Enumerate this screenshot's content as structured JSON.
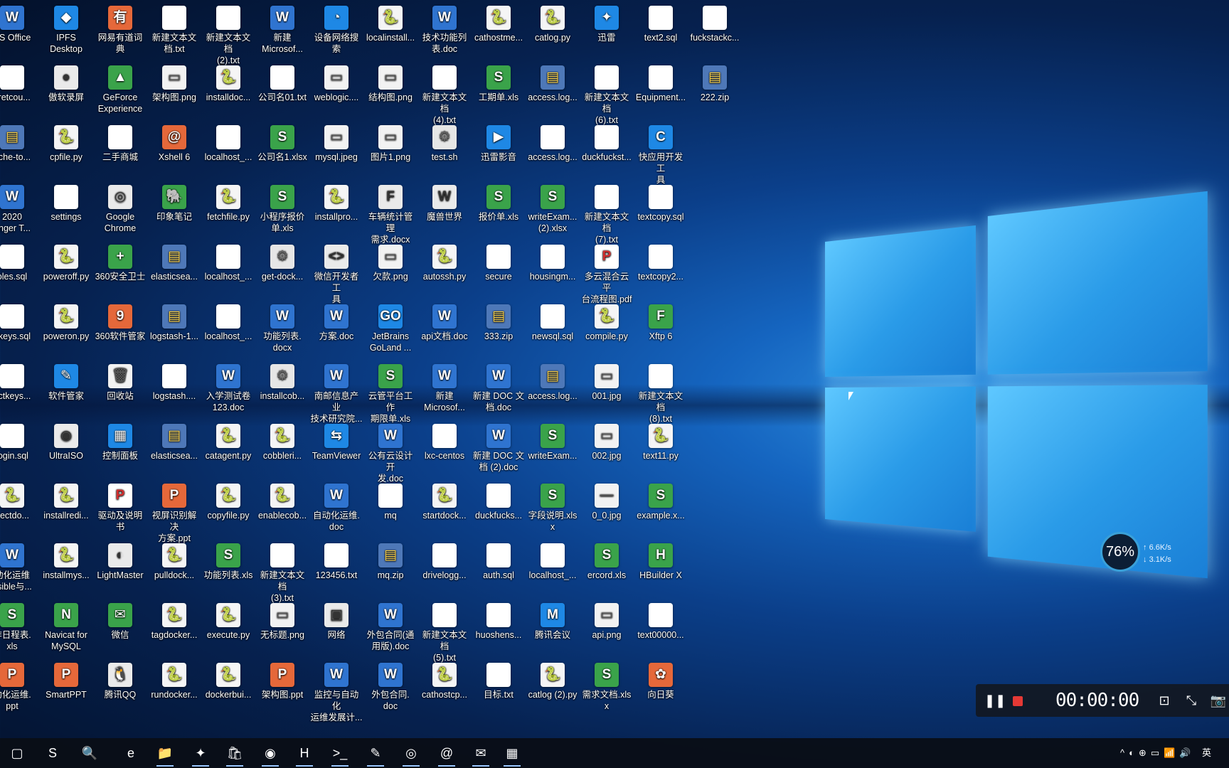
{
  "desktop": {
    "columns": [
      [
        {
          "label": "PS Office",
          "type": "word",
          "glyph": "W"
        },
        {
          "label": "cretcou...",
          "type": "doc",
          "glyph": ""
        },
        {
          "label": "ache-to...",
          "type": "zip",
          "glyph": "▤"
        },
        {
          "label": "2020\nonger T...",
          "type": "word",
          "glyph": "W"
        },
        {
          "label": "oles.sql",
          "type": "doc",
          "glyph": ""
        },
        {
          "label": "hkeys.sql",
          "type": "doc",
          "glyph": ""
        },
        {
          "label": "ectkeys...",
          "type": "doc",
          "glyph": ""
        },
        {
          "label": "login.sql",
          "type": "doc",
          "glyph": ""
        },
        {
          "label": "pectdo...",
          "type": "py",
          "glyph": "🐍"
        },
        {
          "label": "动化运维\nnsible与...",
          "type": "word",
          "glyph": "W"
        },
        {
          "label": "作日程表.\nxls",
          "type": "xls",
          "glyph": "S"
        },
        {
          "label": "动化运维.\nppt",
          "type": "ppt",
          "glyph": "P"
        }
      ],
      [
        {
          "label": "IPFS\nDesktop",
          "type": "app",
          "glyph": "◆"
        },
        {
          "label": "傲软录屏",
          "type": "exe",
          "glyph": "●"
        },
        {
          "label": "cpfile.py",
          "type": "py",
          "glyph": "🐍"
        },
        {
          "label": "settings",
          "type": "doc",
          "glyph": ""
        },
        {
          "label": "poweroff.py",
          "type": "py",
          "glyph": "🐍"
        },
        {
          "label": "poweron.py",
          "type": "py",
          "glyph": "🐍"
        },
        {
          "label": "软件管家",
          "type": "app",
          "glyph": "✎"
        },
        {
          "label": "UltraISO",
          "type": "exe",
          "glyph": "◉"
        },
        {
          "label": "installredi...",
          "type": "py",
          "glyph": "🐍"
        },
        {
          "label": "installmys...",
          "type": "py",
          "glyph": "🐍"
        },
        {
          "label": "Navicat for\nMySQL",
          "type": "xls",
          "glyph": "N"
        },
        {
          "label": "SmartPPT",
          "type": "ppt",
          "glyph": "P"
        }
      ],
      [
        {
          "label": "网易有道词典",
          "type": "ppt",
          "glyph": "有"
        },
        {
          "label": "GeForce\nExperience",
          "type": "xls",
          "glyph": "▲"
        },
        {
          "label": "二手商城",
          "type": "doc",
          "glyph": ""
        },
        {
          "label": "Google\nChrome",
          "type": "exe",
          "glyph": "◎"
        },
        {
          "label": "360安全卫士",
          "type": "xls",
          "glyph": "+"
        },
        {
          "label": "360软件管家",
          "type": "ppt",
          "glyph": "9"
        },
        {
          "label": "回收站",
          "type": "img",
          "glyph": "🗑"
        },
        {
          "label": "控制面板",
          "type": "app",
          "glyph": "▦"
        },
        {
          "label": "驱动及说明书",
          "type": "pdf",
          "glyph": "P"
        },
        {
          "label": "LightMaster",
          "type": "exe",
          "glyph": "◐"
        },
        {
          "label": "微信",
          "type": "xls",
          "glyph": "✉"
        },
        {
          "label": "腾讯QQ",
          "type": "exe",
          "glyph": "🐧"
        }
      ],
      [
        {
          "label": "新建文本文\n档.txt",
          "type": "doc",
          "glyph": ""
        },
        {
          "label": "架构图.png",
          "type": "img",
          "glyph": "▭"
        },
        {
          "label": "Xshell 6",
          "type": "ppt",
          "glyph": "@"
        },
        {
          "label": "印象笔记",
          "type": "xls",
          "glyph": "🐘"
        },
        {
          "label": "elasticsea...",
          "type": "zip",
          "glyph": "▤"
        },
        {
          "label": "logstash-1...",
          "type": "zip",
          "glyph": "▤"
        },
        {
          "label": "logstash....",
          "type": "doc",
          "glyph": ""
        },
        {
          "label": "elasticsea...",
          "type": "zip",
          "glyph": "▤"
        },
        {
          "label": "视屏识别解决\n方案.ppt",
          "type": "ppt",
          "glyph": "P"
        },
        {
          "label": "pulldock...",
          "type": "py",
          "glyph": "🐍"
        },
        {
          "label": "tagdocker...",
          "type": "py",
          "glyph": "🐍"
        },
        {
          "label": "rundocker...",
          "type": "py",
          "glyph": "🐍"
        }
      ],
      [
        {
          "label": "新建文本文档\n(2).txt",
          "type": "doc",
          "glyph": ""
        },
        {
          "label": "installdoc...",
          "type": "py",
          "glyph": "🐍"
        },
        {
          "label": "localhost_...",
          "type": "doc",
          "glyph": ""
        },
        {
          "label": "fetchfile.py",
          "type": "py",
          "glyph": "🐍"
        },
        {
          "label": "localhost_...",
          "type": "doc",
          "glyph": ""
        },
        {
          "label": "localhost_...",
          "type": "doc",
          "glyph": ""
        },
        {
          "label": "入学测试卷\n123.doc",
          "type": "word",
          "glyph": "W"
        },
        {
          "label": "catagent.py",
          "type": "py",
          "glyph": "🐍"
        },
        {
          "label": "copyfile.py",
          "type": "py",
          "glyph": "🐍"
        },
        {
          "label": "功能列表.xls",
          "type": "xls",
          "glyph": "S"
        },
        {
          "label": "execute.py",
          "type": "py",
          "glyph": "🐍"
        },
        {
          "label": "dockerbui...",
          "type": "py",
          "glyph": "🐍"
        }
      ],
      [
        {
          "label": "新建\nMicrosof...",
          "type": "word",
          "glyph": "W"
        },
        {
          "label": "公司名01.txt",
          "type": "doc",
          "glyph": ""
        },
        {
          "label": "公司名1.xlsx",
          "type": "xls",
          "glyph": "S"
        },
        {
          "label": "小程序报价\n单.xls",
          "type": "xls",
          "glyph": "S"
        },
        {
          "label": "get-dock...",
          "type": "sh",
          "glyph": "⚙"
        },
        {
          "label": "功能列表.\ndocx",
          "type": "word",
          "glyph": "W"
        },
        {
          "label": "installcob...",
          "type": "sh",
          "glyph": "⚙"
        },
        {
          "label": "cobbleri...",
          "type": "py",
          "glyph": "🐍"
        },
        {
          "label": "enablecob...",
          "type": "py",
          "glyph": "🐍"
        },
        {
          "label": "新建文本文档\n(3).txt",
          "type": "doc",
          "glyph": ""
        },
        {
          "label": "无标题.png",
          "type": "img",
          "glyph": "▭"
        },
        {
          "label": "架构图.ppt",
          "type": "ppt",
          "glyph": "P"
        }
      ],
      [
        {
          "label": "设备网络搜索",
          "type": "app",
          "glyph": "◔"
        },
        {
          "label": "weblogic....",
          "type": "img",
          "glyph": "▭"
        },
        {
          "label": "mysql.jpeg",
          "type": "img",
          "glyph": "▭"
        },
        {
          "label": "installpro...",
          "type": "py",
          "glyph": "🐍"
        },
        {
          "label": "微信开发者工\n具",
          "type": "exe",
          "glyph": "<>"
        },
        {
          "label": "方案.doc",
          "type": "word",
          "glyph": "W"
        },
        {
          "label": "南邮信息产业\n技术研究院...",
          "type": "word",
          "glyph": "W"
        },
        {
          "label": "TeamViewer",
          "type": "app",
          "glyph": "⇆"
        },
        {
          "label": "自动化运维.\ndoc",
          "type": "word",
          "glyph": "W"
        },
        {
          "label": "123456.txt",
          "type": "doc",
          "glyph": ""
        },
        {
          "label": "网络",
          "type": "exe",
          "glyph": "▣"
        },
        {
          "label": "监控与自动化\n运维发展计...",
          "type": "word",
          "glyph": "W"
        }
      ],
      [
        {
          "label": "localinstall...",
          "type": "py",
          "glyph": "🐍"
        },
        {
          "label": "结构图.png",
          "type": "img",
          "glyph": "▭"
        },
        {
          "label": "图片1.png",
          "type": "img",
          "glyph": "▭"
        },
        {
          "label": "车辆统计管理\n需求.docx",
          "type": "exe",
          "glyph": "F"
        },
        {
          "label": "欠款.png",
          "type": "img",
          "glyph": "▭"
        },
        {
          "label": "JetBrains\nGoLand ...",
          "type": "app",
          "glyph": "GO"
        },
        {
          "label": "云管平台工作\n期限单.xls",
          "type": "xls",
          "glyph": "S"
        },
        {
          "label": "公有云设计开\n发.doc",
          "type": "word",
          "glyph": "W"
        },
        {
          "label": "mq",
          "type": "doc",
          "glyph": ""
        },
        {
          "label": "mq.zip",
          "type": "zip",
          "glyph": "▤"
        },
        {
          "label": "外包合同(通\n用版).doc",
          "type": "word",
          "glyph": "W"
        },
        {
          "label": "外包合同.\ndoc",
          "type": "word",
          "glyph": "W"
        }
      ],
      [
        {
          "label": "技术功能列\n表.doc",
          "type": "word",
          "glyph": "W"
        },
        {
          "label": "新建文本文档\n(4).txt",
          "type": "doc",
          "glyph": ""
        },
        {
          "label": "test.sh",
          "type": "sh",
          "glyph": "⚙"
        },
        {
          "label": "魔兽世界",
          "type": "exe",
          "glyph": "W"
        },
        {
          "label": "autossh.py",
          "type": "py",
          "glyph": "🐍"
        },
        {
          "label": "api文档.doc",
          "type": "word",
          "glyph": "W"
        },
        {
          "label": "新建\nMicrosof...",
          "type": "word",
          "glyph": "W"
        },
        {
          "label": "lxc-centos",
          "type": "doc",
          "glyph": ""
        },
        {
          "label": "startdock...",
          "type": "py",
          "glyph": "🐍"
        },
        {
          "label": "drivelogg...",
          "type": "doc",
          "glyph": ""
        },
        {
          "label": "新建文本文档\n(5).txt",
          "type": "doc",
          "glyph": ""
        },
        {
          "label": "cathostcp...",
          "type": "py",
          "glyph": "🐍"
        }
      ],
      [
        {
          "label": "cathostme...",
          "type": "py",
          "glyph": "🐍"
        },
        {
          "label": "工期单.xls",
          "type": "xls",
          "glyph": "S"
        },
        {
          "label": "迅雷影音",
          "type": "app",
          "glyph": "▶"
        },
        {
          "label": "报价单.xls",
          "type": "xls",
          "glyph": "S"
        },
        {
          "label": "secure",
          "type": "doc",
          "glyph": ""
        },
        {
          "label": "333.zip",
          "type": "zip",
          "glyph": "▤"
        },
        {
          "label": "新建 DOC 文\n档.doc",
          "type": "word",
          "glyph": "W"
        },
        {
          "label": "新建 DOC 文\n档 (2).doc",
          "type": "word",
          "glyph": "W"
        },
        {
          "label": "duckfucks...",
          "type": "doc",
          "glyph": ""
        },
        {
          "label": "auth.sql",
          "type": "doc",
          "glyph": ""
        },
        {
          "label": "huoshens...",
          "type": "doc",
          "glyph": ""
        },
        {
          "label": "目标.txt",
          "type": "doc",
          "glyph": ""
        }
      ],
      [
        {
          "label": "catlog.py",
          "type": "py",
          "glyph": "🐍"
        },
        {
          "label": "access.log...",
          "type": "zip",
          "glyph": "▤"
        },
        {
          "label": "access.log...",
          "type": "doc",
          "glyph": ""
        },
        {
          "label": "writeExam...\n(2).xlsx",
          "type": "xls",
          "glyph": "S"
        },
        {
          "label": "housingm...",
          "type": "doc",
          "glyph": ""
        },
        {
          "label": "newsql.sql",
          "type": "doc",
          "glyph": ""
        },
        {
          "label": "access.log...",
          "type": "zip",
          "glyph": "▤"
        },
        {
          "label": "writeExam...",
          "type": "xls",
          "glyph": "S"
        },
        {
          "label": "字段说明.xlsx",
          "type": "xls",
          "glyph": "S"
        },
        {
          "label": "localhost_...",
          "type": "doc",
          "glyph": ""
        },
        {
          "label": "腾讯会议",
          "type": "app",
          "glyph": "M"
        },
        {
          "label": "catlog (2).py",
          "type": "py",
          "glyph": "🐍"
        }
      ],
      [
        {
          "label": "迅雷",
          "type": "app",
          "glyph": "✦"
        },
        {
          "label": "新建文本文档\n(6).txt",
          "type": "doc",
          "glyph": ""
        },
        {
          "label": "duckfuckst...",
          "type": "doc",
          "glyph": ""
        },
        {
          "label": "新建文本文档\n(7).txt",
          "type": "doc",
          "glyph": ""
        },
        {
          "label": "多云混合云平\n台流程图.pdf",
          "type": "pdf",
          "glyph": "P"
        },
        {
          "label": "compile.py",
          "type": "py",
          "glyph": "🐍"
        },
        {
          "label": "001.jpg",
          "type": "img",
          "glyph": "▭"
        },
        {
          "label": "002.jpg",
          "type": "img",
          "glyph": "▭"
        },
        {
          "label": "0_0.jpg",
          "type": "img",
          "glyph": "—"
        },
        {
          "label": "ercord.xls",
          "type": "xls",
          "glyph": "S"
        },
        {
          "label": "api.png",
          "type": "img",
          "glyph": "▭"
        },
        {
          "label": "需求文档.xlsx",
          "type": "xls",
          "glyph": "S"
        }
      ],
      [
        {
          "label": "text2.sql",
          "type": "doc",
          "glyph": ""
        },
        {
          "label": "Equipment...",
          "type": "doc",
          "glyph": ""
        },
        {
          "label": "快应用开发工\n具",
          "type": "app",
          "glyph": "C"
        },
        {
          "label": "textcopy.sql",
          "type": "doc",
          "glyph": ""
        },
        {
          "label": "textcopy2...",
          "type": "doc",
          "glyph": ""
        },
        {
          "label": "Xftp 6",
          "type": "xls",
          "glyph": "F"
        },
        {
          "label": "新建文本文档\n(8).txt",
          "type": "doc",
          "glyph": ""
        },
        {
          "label": "text11.py",
          "type": "py",
          "glyph": "🐍"
        },
        {
          "label": "example.x...",
          "type": "xls",
          "glyph": "S"
        },
        {
          "label": "HBuilder X",
          "type": "xls",
          "glyph": "H"
        },
        {
          "label": "text00000...",
          "type": "doc",
          "glyph": ""
        },
        {
          "label": "向日葵",
          "type": "ppt",
          "glyph": "✿"
        }
      ],
      [
        {
          "label": "fuckstackc...",
          "type": "doc",
          "glyph": ""
        },
        {
          "label": "222.zip",
          "type": "zip",
          "glyph": "▤"
        }
      ]
    ]
  },
  "gauge": {
    "percent": "76%",
    "up": "6.6K/s",
    "down": "3.1K/s"
  },
  "recorder": {
    "time": "00:00:00"
  },
  "taskbar": {
    "apps": [
      {
        "name": "task-view",
        "glyph": "▢"
      },
      {
        "name": "cortana",
        "glyph": "S"
      },
      {
        "name": "search",
        "glyph": "🔍"
      },
      {
        "name": "edge",
        "glyph": "e"
      },
      {
        "name": "file-explorer",
        "glyph": "📁"
      },
      {
        "name": "thunder",
        "glyph": "✦"
      },
      {
        "name": "store",
        "glyph": "🛍"
      },
      {
        "name": "360",
        "glyph": "◉"
      },
      {
        "name": "hbuilder",
        "glyph": "H"
      },
      {
        "name": "terminal",
        "glyph": ">_"
      },
      {
        "name": "notepad",
        "glyph": "✎"
      },
      {
        "name": "chrome",
        "glyph": "◎"
      },
      {
        "name": "xshell",
        "glyph": "@"
      },
      {
        "name": "wechat",
        "glyph": "✉"
      },
      {
        "name": "game",
        "glyph": "▦"
      }
    ],
    "lang": "英",
    "tray_glyphs": [
      "^",
      "◐",
      "⊕",
      "▭",
      "📶",
      "🔊"
    ]
  },
  "colors": {
    "accent": "#2a9be8"
  }
}
